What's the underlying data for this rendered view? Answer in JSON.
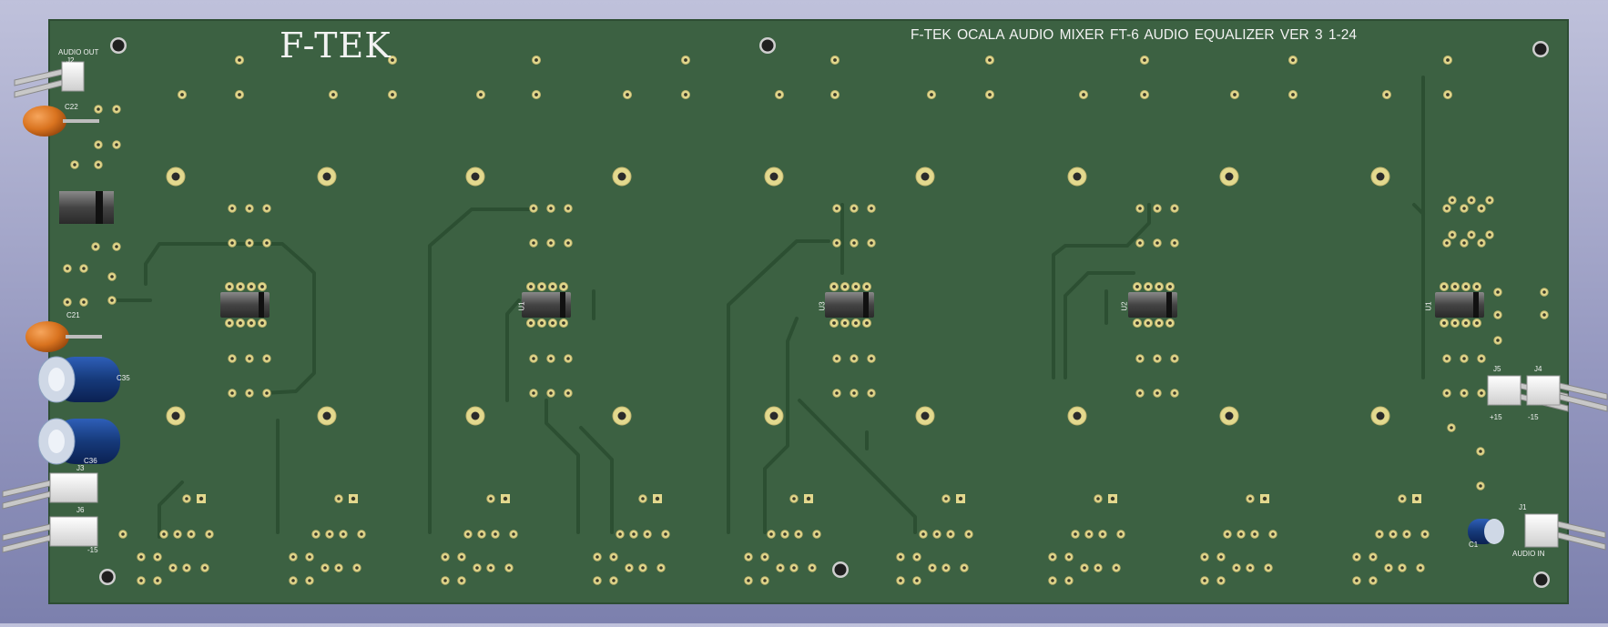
{
  "board": {
    "title": "F-TEK",
    "description": "F-TEK OCALA    AUDIO MIXER   FT-6  AUDIO EQUALIZER    VER 3   1-24",
    "colors": {
      "background": "#a7a9cc",
      "pcb": "#3c6142",
      "trace": "#2c4f32",
      "pad_gold": "#e3d98e",
      "silkscreen": "#f2f2f2"
    }
  },
  "labels": {
    "audio_out": "AUDIO OUT",
    "j2": "J2",
    "c22": "C22",
    "c21": "C21",
    "c35": "C35",
    "c36": "C36",
    "j3": "J3",
    "j6": "J6",
    "j6_val": "-15",
    "j5": "J5",
    "j5_val": "+15",
    "j4": "J4",
    "j4_val": "-15",
    "j1": "J1",
    "audio_in": "AUDIO IN",
    "c1": "C1",
    "u_a": "U1",
    "u_b": "U3",
    "u_c": "U2",
    "u_d": "U1"
  }
}
